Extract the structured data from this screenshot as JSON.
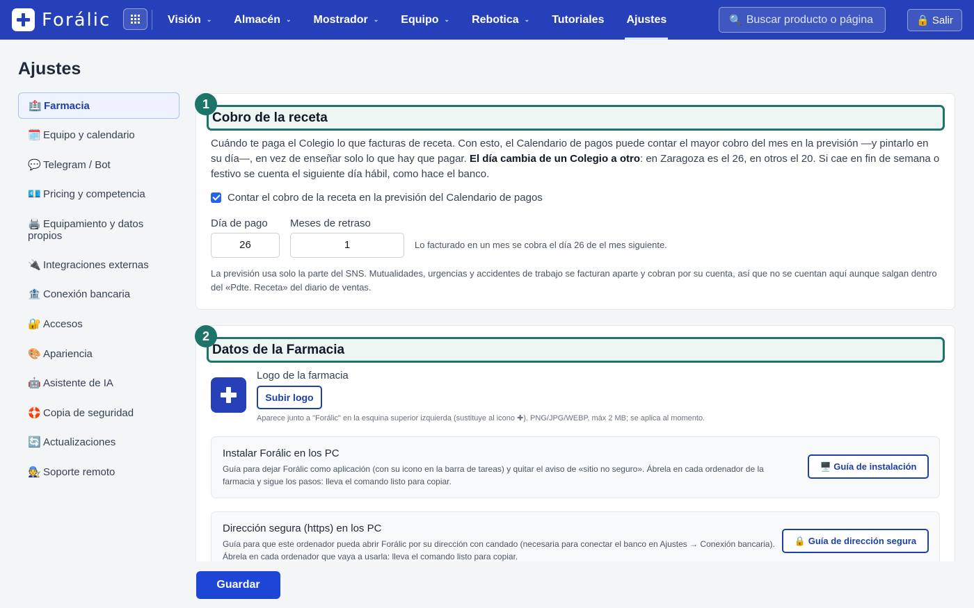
{
  "app": {
    "name": "Forálic"
  },
  "nav": {
    "items": [
      {
        "label": "Visión",
        "has_menu": true
      },
      {
        "label": "Almacén",
        "has_menu": true
      },
      {
        "label": "Mostrador",
        "has_menu": true
      },
      {
        "label": "Equipo",
        "has_menu": true
      },
      {
        "label": "Rebotica",
        "has_menu": true
      },
      {
        "label": "Tutoriales",
        "has_menu": false
      },
      {
        "label": "Ajustes",
        "has_menu": false,
        "active": true
      }
    ],
    "search_placeholder": "Buscar producto o página",
    "logout_label": "🔒 Salir"
  },
  "page": {
    "title": "Ajustes"
  },
  "sidebar": {
    "items": [
      {
        "icon": "🏥",
        "label": "Farmacia",
        "active": true
      },
      {
        "icon": "🗓️",
        "label": "Equipo y calendario"
      },
      {
        "icon": "💬",
        "label": "Telegram / Bot"
      },
      {
        "icon": "💶",
        "label": "Pricing y competencia"
      },
      {
        "icon": "🖨️",
        "label": "Equipamiento y datos propios"
      },
      {
        "icon": "🔌",
        "label": "Integraciones externas"
      },
      {
        "icon": "🏦",
        "label": "Conexión bancaria"
      },
      {
        "icon": "🔐",
        "label": "Accesos"
      },
      {
        "icon": "🎨",
        "label": "Apariencia"
      },
      {
        "icon": "🤖",
        "label": "Asistente de IA"
      },
      {
        "icon": "🛟",
        "label": "Copia de seguridad"
      },
      {
        "icon": "🔄",
        "label": "Actualizaciones"
      },
      {
        "icon": "🧑‍🔧",
        "label": "Soporte remoto"
      }
    ]
  },
  "section1": {
    "step": "1",
    "title": "Cobro de la receta",
    "desc_part1": "Cuándo te paga el Colegio lo que facturas de receta. Con esto, el Calendario de pagos puede contar el mayor cobro del mes en la previsión —y pintarlo en su día—, en vez de enseñar solo lo que hay que pagar. ",
    "desc_bold": "El día cambia de un Colegio a otro",
    "desc_part2": ": en Zaragoza es el 26, en otros el 20. Si cae en fin de semana o festivo se cuenta el siguiente día hábil, como hace el banco.",
    "checkbox_label": "Contar el cobro de la receta en la previsión del Calendario de pagos",
    "checkbox_checked": true,
    "day_label": "Día de pago",
    "day_value": "26",
    "delay_label": "Meses de retraso",
    "delay_value": "1",
    "hint": "Lo facturado en un mes se cobra el día 26 de el mes siguiente.",
    "footnote": "La previsión usa solo la parte del SNS. Mutualidades, urgencias y accidentes de trabajo se facturan aparte y cobran por su cuenta, así que no se cuentan aquí aunque salgan dentro del «Pdte. Receta» del diario de ventas."
  },
  "section2": {
    "step": "2",
    "title": "Datos de la Farmacia",
    "logo_label": "Logo de la farmacia",
    "upload_label": "Subir logo",
    "logo_note": "Aparece junto a \"Forálic\" en la esquina superior izquierda (sustituye al icono ✚). PNG/JPG/WEBP, máx 2 MB; se aplica al momento.",
    "install": {
      "title": "Instalar Forálic en los PC",
      "desc": "Guía para dejar Forálic como aplicación (con su icono en la barra de tareas) y quitar el aviso de «sitio no seguro». Ábrela en cada ordenador de la farmacia y sigue los pasos: lleva el comando listo para copiar.",
      "button": "🖥️ Guía de instalación"
    },
    "https": {
      "title": "Dirección segura (https) en los PC",
      "desc": "Guía para que este ordenador pueda abrir Forálic por su dirección con candado (necesaria para conectar el banco en Ajustes → Conexión bancaria). Ábrela en cada ordenador que vaya a usarla: lleva el comando listo para copiar.",
      "button": "🔒 Guía de dirección segura"
    }
  },
  "footer": {
    "save_label": "Guardar"
  },
  "colors": {
    "brand": "#2540b8",
    "accent_teal": "#1d7468",
    "primary_button": "#1d46d6"
  }
}
